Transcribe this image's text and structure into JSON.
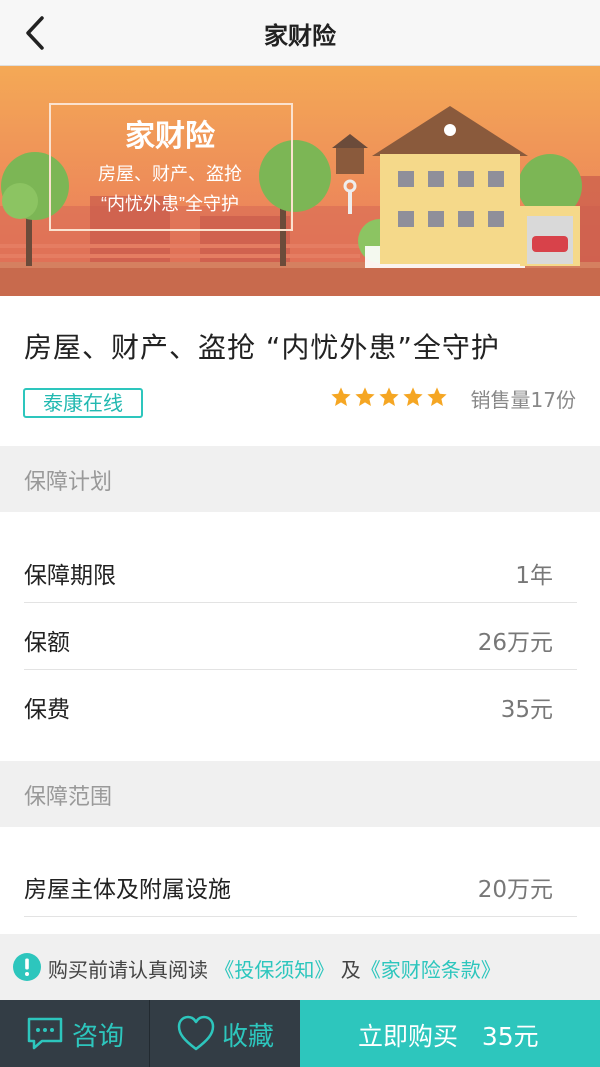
{
  "header": {
    "title": "家财险",
    "back_icon": "chevron-left-icon"
  },
  "banner": {
    "title": "家财险",
    "line1": "房屋、财产、盗抢",
    "line2": "“内忧外患”全守护",
    "colors": {
      "sky_top": "#f2a35a",
      "sky_bottom": "#e9765a",
      "house": "#f5d98a"
    }
  },
  "product": {
    "headline": "房屋、财产、盗抢 “内忧外患”全守护",
    "provider_tag": "泰康在线",
    "rating": 5,
    "sales": "销售量17份",
    "star_color": "#f5a623"
  },
  "plan": {
    "title": "保障计划",
    "rows": [
      {
        "label": "保障期限",
        "value": "1年"
      },
      {
        "label": "保额",
        "value": "26万元"
      },
      {
        "label": "保费",
        "value": "35元"
      }
    ]
  },
  "scope": {
    "title": "保障范围",
    "rows": [
      {
        "label": "房屋主体及附属设施",
        "value": "20万元"
      }
    ]
  },
  "notice": {
    "prefix": "购买前请认真阅读",
    "link1": "《投保须知》",
    "middle": "及",
    "link2": "《家财险条款》",
    "icon": "exclamation-circle-icon"
  },
  "actions": {
    "consult": "咨询",
    "favorite": "收藏",
    "buy_label": "立即购买",
    "buy_price": "35元",
    "accent": "#2dc6bd",
    "dark": "#333d45"
  }
}
